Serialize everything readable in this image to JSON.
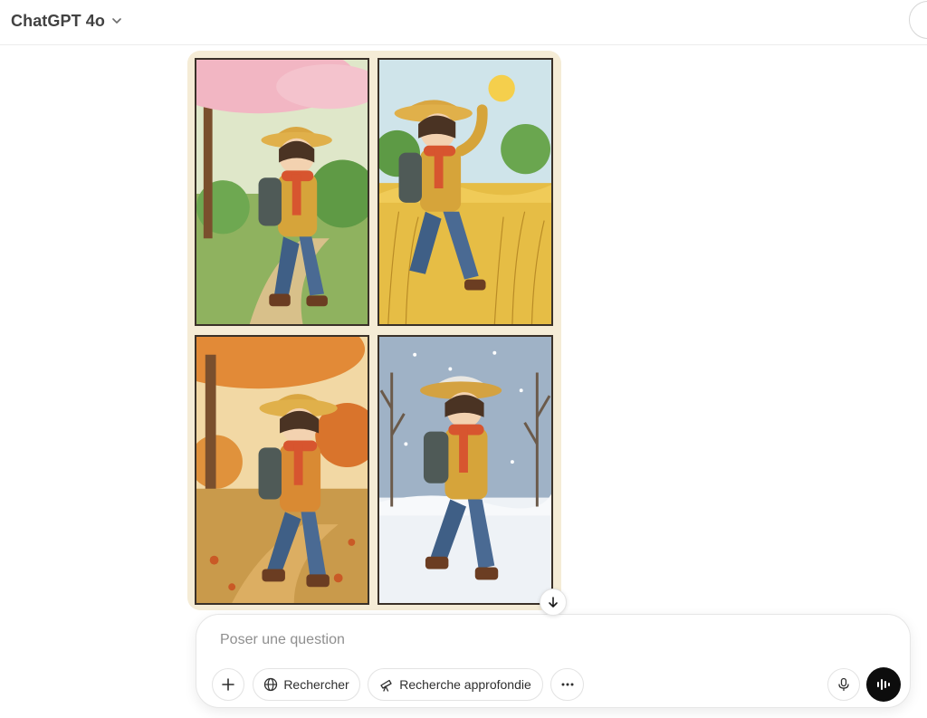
{
  "header": {
    "model_name": "ChatGPT 4o",
    "model_menu_icon": "chevron-down-icon"
  },
  "image_message": {
    "panels": [
      "spring-panel",
      "summer-panel",
      "autumn-panel",
      "winter-panel"
    ],
    "scroll_down_icon": "arrow-down-icon"
  },
  "composer": {
    "placeholder": "Poser une question",
    "value": "",
    "buttons": {
      "add_icon": "plus-icon",
      "search_label": "Rechercher",
      "search_icon": "globe-icon",
      "deep_research_label": "Recherche approfondie",
      "deep_research_icon": "telescope-icon",
      "more_icon": "more-horizontal-icon",
      "mic_icon": "microphone-icon",
      "voice_icon": "voice-waveform-icon"
    }
  },
  "colors": {
    "accent_dark": "#0d0d0d",
    "card_background": "#f5ecd6",
    "border": "#e3e3e3"
  }
}
